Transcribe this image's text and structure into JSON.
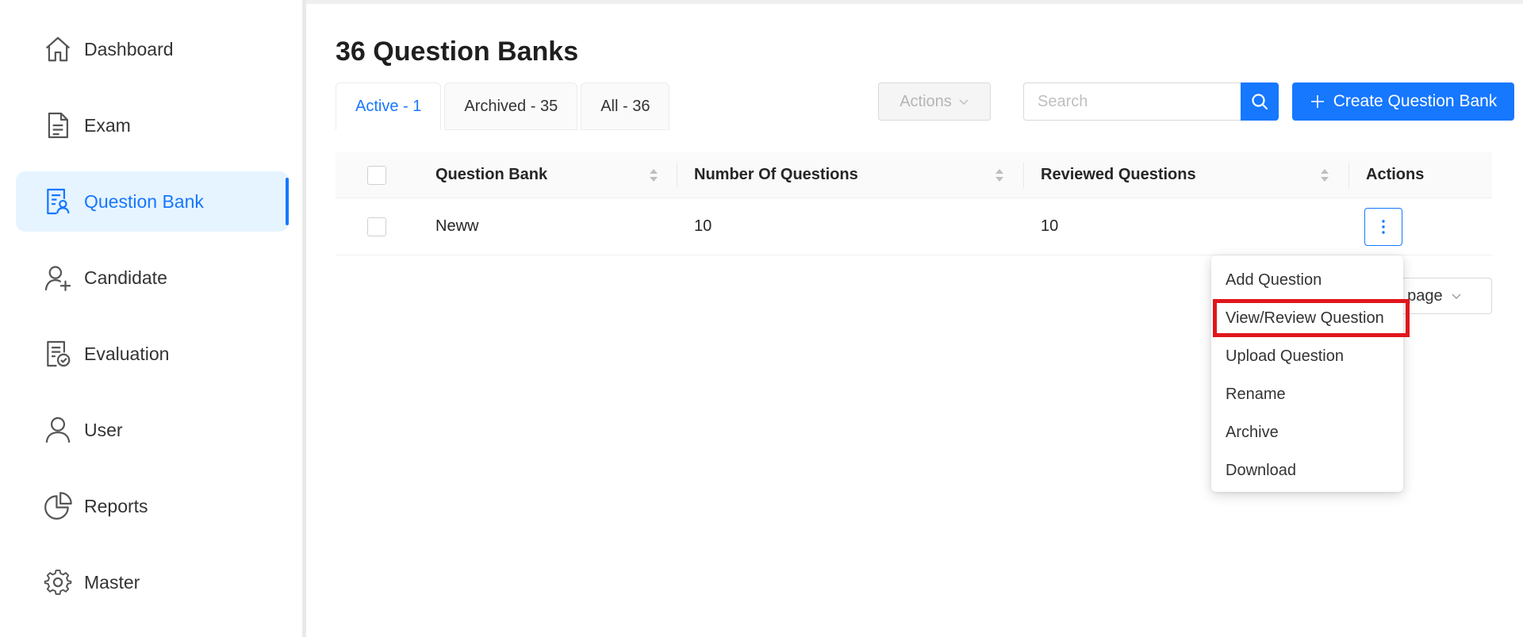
{
  "sidebar": {
    "items": [
      {
        "label": "Dashboard",
        "icon": "home-icon"
      },
      {
        "label": "Exam",
        "icon": "document-icon"
      },
      {
        "label": "Question Bank",
        "icon": "question-bank-icon",
        "active": true
      },
      {
        "label": "Candidate",
        "icon": "candidate-icon"
      },
      {
        "label": "Evaluation",
        "icon": "evaluation-icon"
      },
      {
        "label": "User",
        "icon": "user-icon"
      },
      {
        "label": "Reports",
        "icon": "pie-chart-icon"
      },
      {
        "label": "Master",
        "icon": "gear-icon"
      }
    ]
  },
  "main": {
    "title": "36 Question Banks",
    "tabs": [
      {
        "label": "Active - 1",
        "active": true
      },
      {
        "label": "Archived - 35"
      },
      {
        "label": "All - 36"
      }
    ],
    "actions_label": "Actions",
    "search": {
      "placeholder": "Search",
      "value": ""
    },
    "create_label": "Create Question Bank"
  },
  "table": {
    "headers": [
      "Question Bank",
      "Number Of Questions",
      "Reviewed Questions",
      "Actions"
    ],
    "rows": [
      {
        "name": "Neww",
        "questions": "10",
        "reviewed": "10"
      }
    ]
  },
  "pagination": {
    "page_size_label": "/ page"
  },
  "dropdown": {
    "items": [
      "Add Question",
      "View/Review Question",
      "Upload Question",
      "Rename",
      "Archive",
      "Download"
    ],
    "highlighted": "View/Review Question"
  },
  "colors": {
    "accent": "#1677ff",
    "highlight": "#e0161c",
    "active_bg": "#e6f4ff"
  }
}
